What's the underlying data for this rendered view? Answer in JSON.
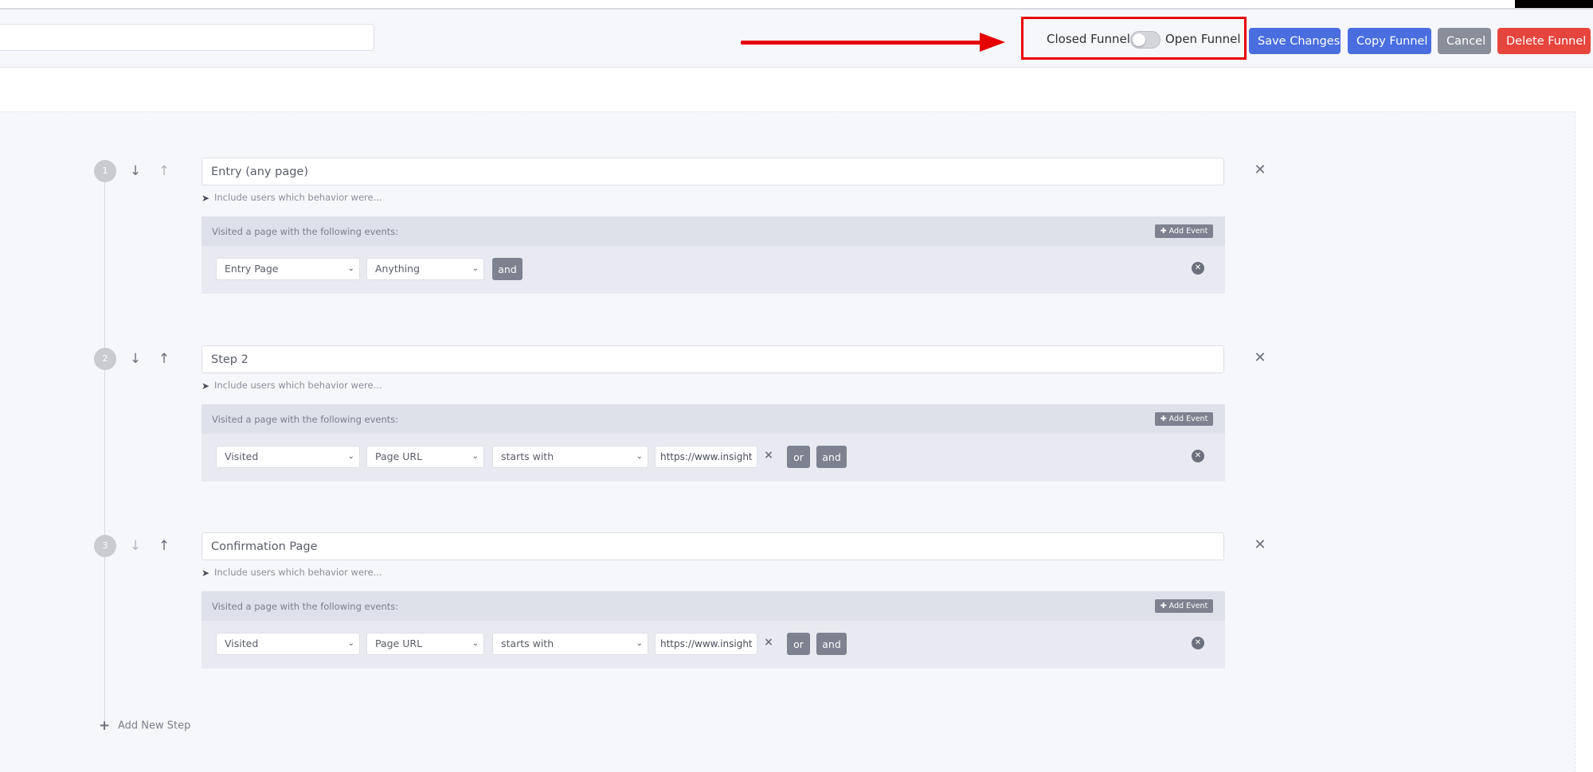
{
  "header": {
    "funnel_name_value": "",
    "toggle_left_label": "Closed Funnel",
    "toggle_right_label": "Open Funnel",
    "save_label": "Save Changes",
    "copy_label": "Copy Funnel",
    "cancel_label": "Cancel",
    "delete_label": "Delete Funnel"
  },
  "common": {
    "behavior_hint": "Include users which behavior were...",
    "events_title": "Visited a page with the following events:",
    "add_event_label": "Add Event",
    "and_label": "and",
    "or_label": "or"
  },
  "steps": [
    {
      "number": "1",
      "name": "Entry (any page)",
      "event": {
        "field": "Entry Page",
        "operator": "Anything"
      }
    },
    {
      "number": "2",
      "name": "Step 2",
      "event": {
        "action": "Visited",
        "field": "Page URL",
        "operator": "starts with",
        "value": "https://www.insight"
      }
    },
    {
      "number": "3",
      "name": "Confirmation Page",
      "event": {
        "action": "Visited",
        "field": "Page URL",
        "operator": "starts with",
        "value": "https://www.insight"
      }
    }
  ],
  "footer": {
    "add_step_label": "Add New Step"
  },
  "icons": {
    "down": "↓",
    "up": "↑",
    "close": "✕",
    "chevron": "⌄",
    "pointer": "➤",
    "plus": "+",
    "clear": "×"
  },
  "colors": {
    "primary": "#4a6ee0",
    "danger": "#e6453d",
    "neutral": "#8a8e99",
    "annotation": "#e60000"
  }
}
